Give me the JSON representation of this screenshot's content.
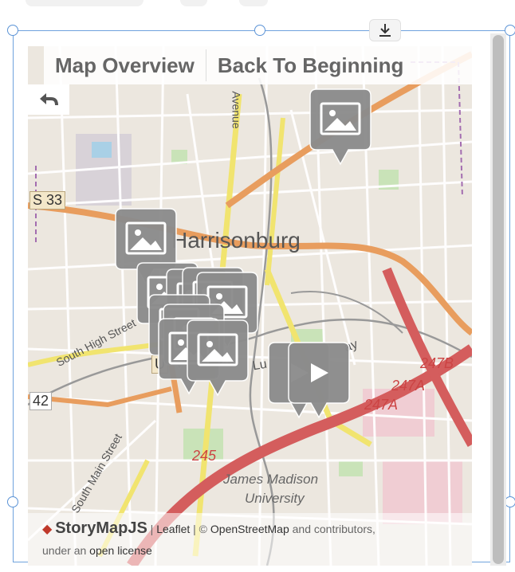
{
  "toolbar": {
    "download_icon": "download-icon"
  },
  "nav": {
    "map_overview_label": "Map Overview",
    "back_to_beginning_label": "Back To Beginning",
    "back_icon": "back-arrow-icon"
  },
  "map": {
    "city_label": "Harrisonburg",
    "university_label_line1": "James Madison",
    "university_label_line2": "University",
    "road_labels": {
      "us33": "S 33",
      "us11": "U",
      "sr42": "42",
      "r247b": "247B",
      "r247a_1": "247A",
      "r247a_2": "247A",
      "r245": "245",
      "main_ave": "Avenue",
      "south_high": "South High Street",
      "south_main": "South Main Street",
      "lu": "Lu",
      "ay": "ay"
    },
    "markers": [
      {
        "kind": "image"
      },
      {
        "kind": "image"
      },
      {
        "kind": "image"
      },
      {
        "kind": "image"
      },
      {
        "kind": "image"
      },
      {
        "kind": "image"
      },
      {
        "kind": "image"
      },
      {
        "kind": "image"
      },
      {
        "kind": "image"
      },
      {
        "kind": "video"
      },
      {
        "kind": "image"
      },
      {
        "kind": "video"
      }
    ]
  },
  "attribution": {
    "brand": "StoryMapJS",
    "sep1": " | ",
    "leaflet": "Leaflet",
    "sep2": " | © ",
    "osm": "OpenStreetMap",
    "rest": " and contributors,",
    "line2_prefix": "under an ",
    "license": "open license"
  },
  "colors": {
    "selection_border": "#6fa2dd",
    "marker_fill": "#8c8c8c",
    "brand_diamond": "#c0392b",
    "major_road": "#e89d5e",
    "highway": "#d45d5d",
    "secondary_road": "#f1e46f"
  }
}
